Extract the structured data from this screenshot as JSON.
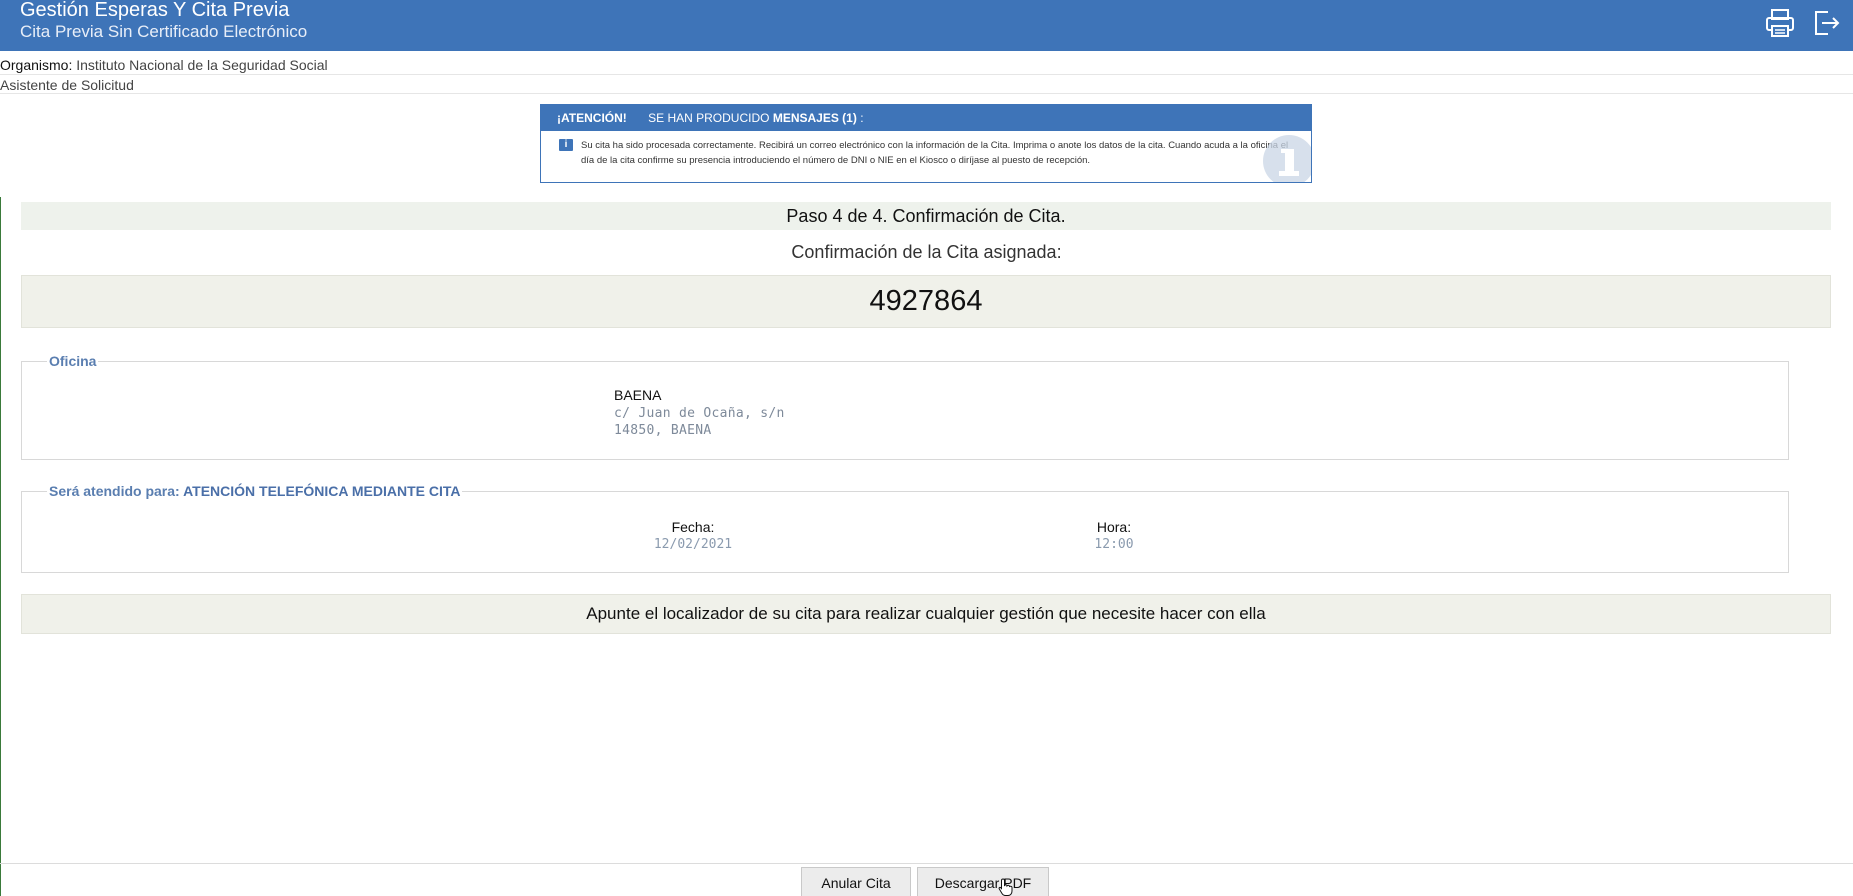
{
  "header": {
    "title": "Gestión Esperas Y Cita Previa",
    "subtitle": "Cita Previa Sin Certificado Electrónico",
    "print_icon": "printer-icon",
    "logout_icon": "logout-icon"
  },
  "info": {
    "organismo_label": "Organismo:",
    "organismo_value": "Instituto Nacional de la Seguridad Social",
    "asistente": "Asistente de Solicitud"
  },
  "alert": {
    "attention": "¡ATENCIÓN!",
    "pre": "SE HAN PRODUCIDO",
    "mensajes": "MENSAJES (1)",
    "suffix": " :",
    "icon": "info-icon",
    "message": "Su cita ha sido procesada correctamente. Recibirá un correo electrónico con la información de la Cita. Imprima o anote los datos de la cita. Cuando acuda a la oficina el día de la cita confirme su presencia introduciendo el número de DNI o NIE en el Kiosco o diríjase al puesto de recepción."
  },
  "step": "Paso 4 de 4. Confirmación de Cita.",
  "confirmation": {
    "label": "Confirmación de la Cita asignada:",
    "code": "4927864"
  },
  "oficina": {
    "legend": "Oficina",
    "name": "BAENA",
    "address1": "c/ Juan de Ocaña, s/n",
    "address2": "14850, BAENA"
  },
  "atendido": {
    "legend_prefix": "Será atendido para:",
    "legend_value": "ATENCIÓN TELEFÓNICA MEDIANTE CITA",
    "fecha_label": "Fecha:",
    "fecha_value": "12/02/2021",
    "hora_label": "Hora:",
    "hora_value": "12:00"
  },
  "note": "Apunte el localizador de su cita para realizar cualquier gestión que necesite hacer con ella",
  "buttons": {
    "anular": "Anular Cita",
    "descargar": "Descargar PDF"
  },
  "colors": {
    "header": "#3e74b8",
    "bar": "#eef2ec",
    "legend": "#5a7eb0"
  }
}
